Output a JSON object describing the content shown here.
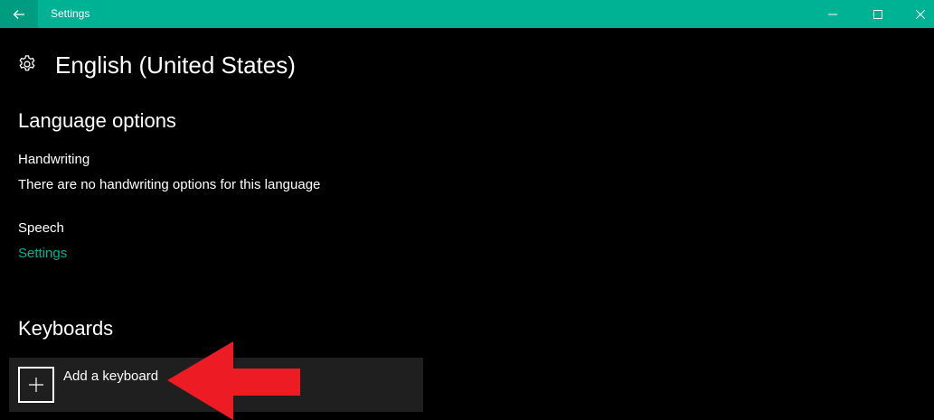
{
  "window": {
    "title": "Settings",
    "accent_color": "#00b294",
    "back_icon": "arrow-left-icon",
    "controls": [
      "minimize-icon",
      "maximize-icon",
      "close-icon"
    ]
  },
  "page": {
    "icon": "gear-icon",
    "title": "English (United States)"
  },
  "language_options": {
    "heading": "Language options",
    "handwriting_label": "Handwriting",
    "handwriting_desc": "There are no handwriting options for this language",
    "speech_label": "Speech",
    "speech_link": "Settings"
  },
  "keyboards": {
    "heading": "Keyboards",
    "add_label": "Add a keyboard",
    "add_icon": "plus-icon"
  },
  "annotation": {
    "arrow_color": "#ed1c24",
    "arrow_icon": "red-arrow-pointer"
  }
}
